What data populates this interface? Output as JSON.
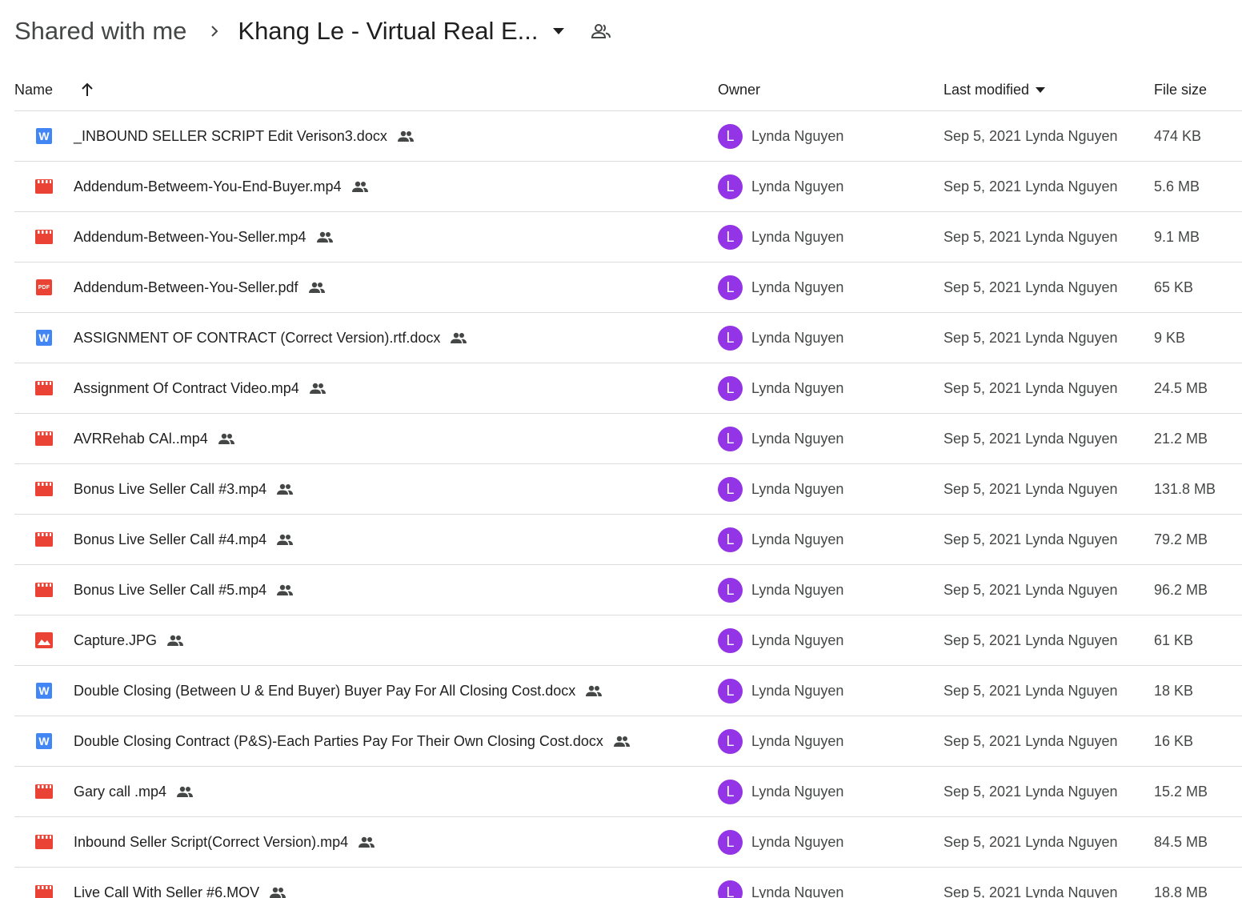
{
  "breadcrumb": {
    "root": "Shared with me",
    "current": "Khang Le - Virtual Real E..."
  },
  "table": {
    "columns": {
      "name": "Name",
      "owner": "Owner",
      "last_modified": "Last modified",
      "file_size": "File size"
    },
    "rows": [
      {
        "type": "docx",
        "name": "_INBOUND SELLER SCRIPT Edit Verison3.docx",
        "owner_initial": "L",
        "owner": "Lynda Nguyen",
        "modified": "Sep 5, 2021 Lynda Nguyen",
        "size": "474 KB"
      },
      {
        "type": "video",
        "name": "Addendum-Betweem-You-End-Buyer.mp4",
        "owner_initial": "L",
        "owner": "Lynda Nguyen",
        "modified": "Sep 5, 2021 Lynda Nguyen",
        "size": "5.6 MB"
      },
      {
        "type": "video",
        "name": "Addendum-Between-You-Seller.mp4",
        "owner_initial": "L",
        "owner": "Lynda Nguyen",
        "modified": "Sep 5, 2021 Lynda Nguyen",
        "size": "9.1 MB"
      },
      {
        "type": "pdf",
        "name": "Addendum-Between-You-Seller.pdf",
        "owner_initial": "L",
        "owner": "Lynda Nguyen",
        "modified": "Sep 5, 2021 Lynda Nguyen",
        "size": "65 KB"
      },
      {
        "type": "docx",
        "name": "ASSIGNMENT OF CONTRACT (Correct Version).rtf.docx",
        "owner_initial": "L",
        "owner": "Lynda Nguyen",
        "modified": "Sep 5, 2021 Lynda Nguyen",
        "size": "9 KB"
      },
      {
        "type": "video",
        "name": "Assignment Of Contract Video.mp4",
        "owner_initial": "L",
        "owner": "Lynda Nguyen",
        "modified": "Sep 5, 2021 Lynda Nguyen",
        "size": "24.5 MB"
      },
      {
        "type": "video",
        "name": "AVRRehab CAl..mp4",
        "owner_initial": "L",
        "owner": "Lynda Nguyen",
        "modified": "Sep 5, 2021 Lynda Nguyen",
        "size": "21.2 MB"
      },
      {
        "type": "video",
        "name": "Bonus Live Seller Call #3.mp4",
        "owner_initial": "L",
        "owner": "Lynda Nguyen",
        "modified": "Sep 5, 2021 Lynda Nguyen",
        "size": "131.8 MB"
      },
      {
        "type": "video",
        "name": "Bonus Live Seller Call #4.mp4",
        "owner_initial": "L",
        "owner": "Lynda Nguyen",
        "modified": "Sep 5, 2021 Lynda Nguyen",
        "size": "79.2 MB"
      },
      {
        "type": "video",
        "name": "Bonus Live Seller Call #5.mp4",
        "owner_initial": "L",
        "owner": "Lynda Nguyen",
        "modified": "Sep 5, 2021 Lynda Nguyen",
        "size": "96.2 MB"
      },
      {
        "type": "image",
        "name": "Capture.JPG",
        "owner_initial": "L",
        "owner": "Lynda Nguyen",
        "modified": "Sep 5, 2021 Lynda Nguyen",
        "size": "61 KB"
      },
      {
        "type": "docx",
        "name": "Double Closing (Between U & End Buyer) Buyer Pay For All Closing Cost.docx",
        "owner_initial": "L",
        "owner": "Lynda Nguyen",
        "modified": "Sep 5, 2021 Lynda Nguyen",
        "size": "18 KB"
      },
      {
        "type": "docx",
        "name": "Double Closing Contract (P&S)-Each Parties Pay For Their Own Closing Cost.docx",
        "owner_initial": "L",
        "owner": "Lynda Nguyen",
        "modified": "Sep 5, 2021 Lynda Nguyen",
        "size": "16 KB"
      },
      {
        "type": "video",
        "name": "Gary call .mp4",
        "owner_initial": "L",
        "owner": "Lynda Nguyen",
        "modified": "Sep 5, 2021 Lynda Nguyen",
        "size": "15.2 MB"
      },
      {
        "type": "video",
        "name": "Inbound Seller Script(Correct Version).mp4",
        "owner_initial": "L",
        "owner": "Lynda Nguyen",
        "modified": "Sep 5, 2021 Lynda Nguyen",
        "size": "84.5 MB"
      },
      {
        "type": "video",
        "name": "Live Call With Seller #6.MOV",
        "owner_initial": "L",
        "owner": "Lynda Nguyen",
        "modified": "Sep 5, 2021 Lynda Nguyen",
        "size": "18.8 MB"
      }
    ]
  },
  "icons": {
    "docx": "word-doc-icon",
    "video": "video-file-icon",
    "pdf": "pdf-file-icon",
    "image": "image-file-icon",
    "pdf_badge_text": "PDF",
    "docx_badge_text": "W"
  },
  "colors": {
    "avatar": "#9334e6",
    "word": "#4285f4",
    "red_file": "#ea4335",
    "divider": "#dadce0"
  }
}
